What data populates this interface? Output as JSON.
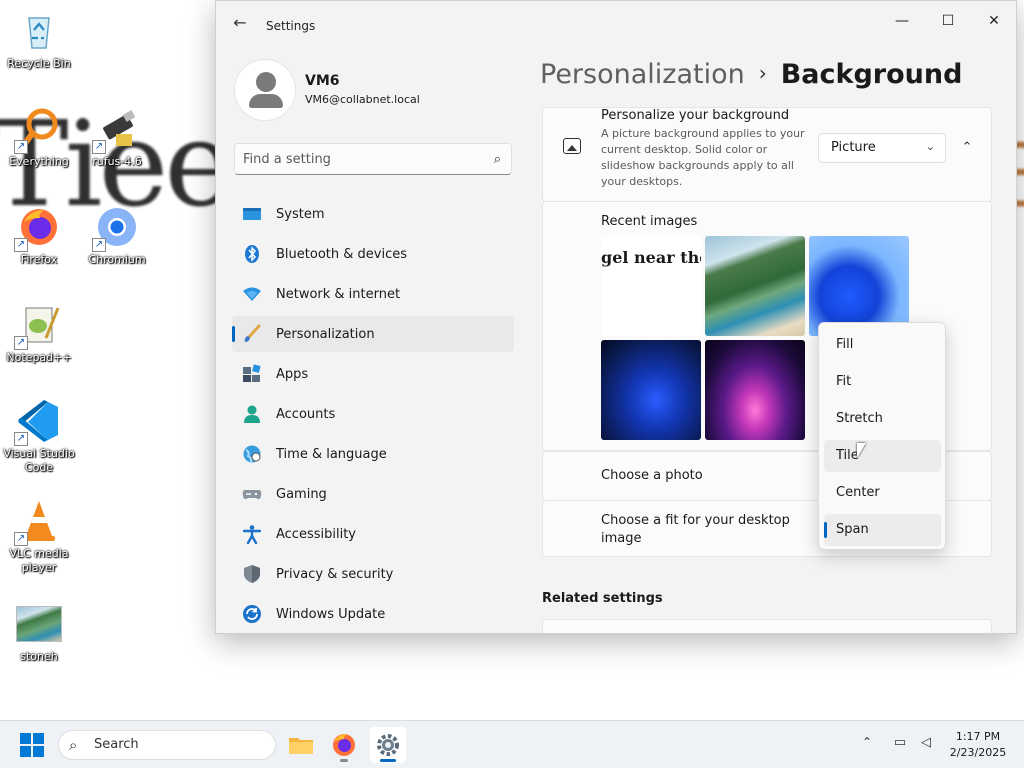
{
  "desktop": {
    "icons": [
      {
        "label": "Recycle Bin"
      },
      {
        "label": "Everything"
      },
      {
        "label": "rufus-4.6"
      },
      {
        "label": "Firefox"
      },
      {
        "label": "Chromium"
      },
      {
        "label": "Notepad++"
      },
      {
        "label": "Visual Studio Code"
      },
      {
        "label": "VLC media player"
      },
      {
        "label": "stoneh"
      }
    ]
  },
  "window": {
    "title": "Settings",
    "controls": {
      "minimize": "—",
      "maximize": "☐",
      "close": "✕"
    }
  },
  "user": {
    "name": "VM6",
    "email": "VM6@collabnet.local"
  },
  "search": {
    "placeholder": "Find a setting"
  },
  "nav": {
    "items": [
      {
        "label": "System",
        "icon": "system-icon"
      },
      {
        "label": "Bluetooth & devices",
        "icon": "bluetooth-icon"
      },
      {
        "label": "Network & internet",
        "icon": "network-icon"
      },
      {
        "label": "Personalization",
        "icon": "brush-icon",
        "active": true
      },
      {
        "label": "Apps",
        "icon": "apps-icon"
      },
      {
        "label": "Accounts",
        "icon": "accounts-icon"
      },
      {
        "label": "Time & language",
        "icon": "globe-icon"
      },
      {
        "label": "Gaming",
        "icon": "gamepad-icon"
      },
      {
        "label": "Accessibility",
        "icon": "accessibility-icon"
      },
      {
        "label": "Privacy & security",
        "icon": "shield-icon"
      },
      {
        "label": "Windows Update",
        "icon": "update-icon"
      }
    ]
  },
  "breadcrumb": {
    "parent": "Personalization",
    "separator": "›",
    "current": "Background"
  },
  "background_card": {
    "title": "Personalize your background",
    "description": "A picture background applies to your current desktop. Solid color or slideshow backgrounds apply to all your desktops.",
    "dropdown_value": "Picture"
  },
  "recent_images": {
    "label": "Recent images",
    "text_thumb": "gel near the N"
  },
  "choose_photo": {
    "label": "Choose a photo"
  },
  "choose_fit": {
    "label": "Choose a fit for your desktop image"
  },
  "fit_menu": {
    "options": [
      "Fill",
      "Fit",
      "Stretch",
      "Tile",
      "Center",
      "Span"
    ],
    "hovered": "Tile",
    "selected": "Span"
  },
  "related": {
    "heading": "Related settings"
  },
  "taskbar": {
    "search_label": "Search",
    "time": "1:17 PM",
    "date": "2/23/2025"
  },
  "colors": {
    "accent": "#0067c0",
    "window_bg": "#f3f3f3",
    "card_bg": "#fbfbfb"
  }
}
